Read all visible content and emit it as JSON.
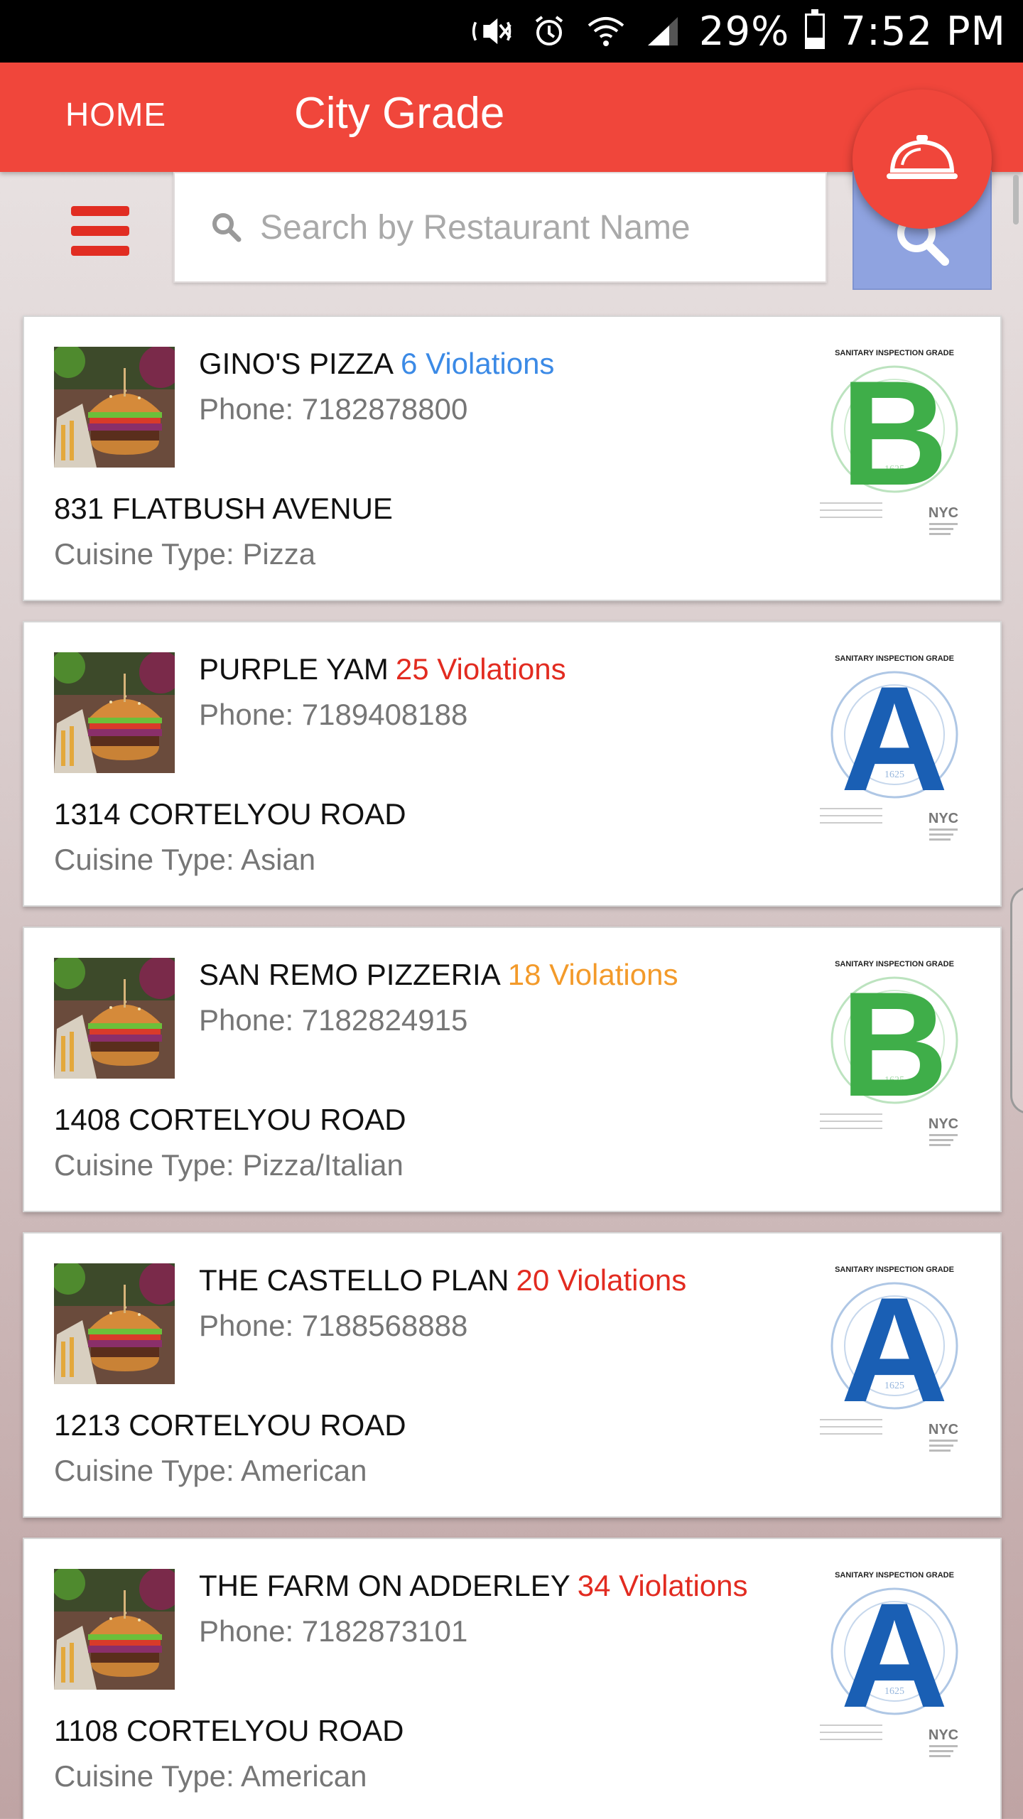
{
  "status_bar": {
    "battery": "29%",
    "battery_level": 0.29,
    "time": "7:52 PM",
    "icons": [
      "mute-icon",
      "alarm-icon",
      "wifi-icon",
      "signal-icon",
      "battery-icon"
    ]
  },
  "app_bar": {
    "home_label": "HOME",
    "title": "City Grade",
    "background": "#f0463b",
    "fab_icon": "service-bell-icon"
  },
  "search": {
    "placeholder": "Search by Restaurant Name",
    "value": "",
    "button_color": "#8fa3e0"
  },
  "grade_card": {
    "heading": "SANITARY INSPECTION GRADE",
    "logo": "NYC",
    "seal_year": "1625"
  },
  "grade_colors": {
    "A": "#1a5fb4",
    "B": "#3fae49"
  },
  "restaurants": [
    {
      "name": "GINO'S PIZZA",
      "violations": "6 Violations",
      "violations_color": "#3b8ae6",
      "phone": "Phone: 7182878800",
      "address": "831 FLATBUSH AVENUE",
      "cuisine": "Cuisine Type: Pizza",
      "grade": "B"
    },
    {
      "name": "PURPLE YAM",
      "violations": "25 Violations",
      "violations_color": "#e22b20",
      "phone": "Phone: 7189408188",
      "address": "1314 CORTELYOU ROAD",
      "cuisine": "Cuisine Type: Asian",
      "grade": "A"
    },
    {
      "name": "SAN REMO PIZZERIA",
      "violations": "18 Violations",
      "violations_color": "#f39a2a",
      "phone": "Phone: 7182824915",
      "address": "1408 CORTELYOU ROAD",
      "cuisine": "Cuisine Type: Pizza/Italian",
      "grade": "B"
    },
    {
      "name": "THE CASTELLO PLAN",
      "violations": "20 Violations",
      "violations_color": "#e22b20",
      "phone": "Phone: 7188568888",
      "address": "1213 CORTELYOU ROAD",
      "cuisine": "Cuisine Type: American",
      "grade": "A"
    },
    {
      "name": "THE FARM ON ADDERLEY",
      "violations": "34 Violations",
      "violations_color": "#e22b20",
      "phone": "Phone: 7182873101",
      "address": "1108 CORTELYOU ROAD",
      "cuisine": "Cuisine Type: American",
      "grade": "A"
    }
  ]
}
